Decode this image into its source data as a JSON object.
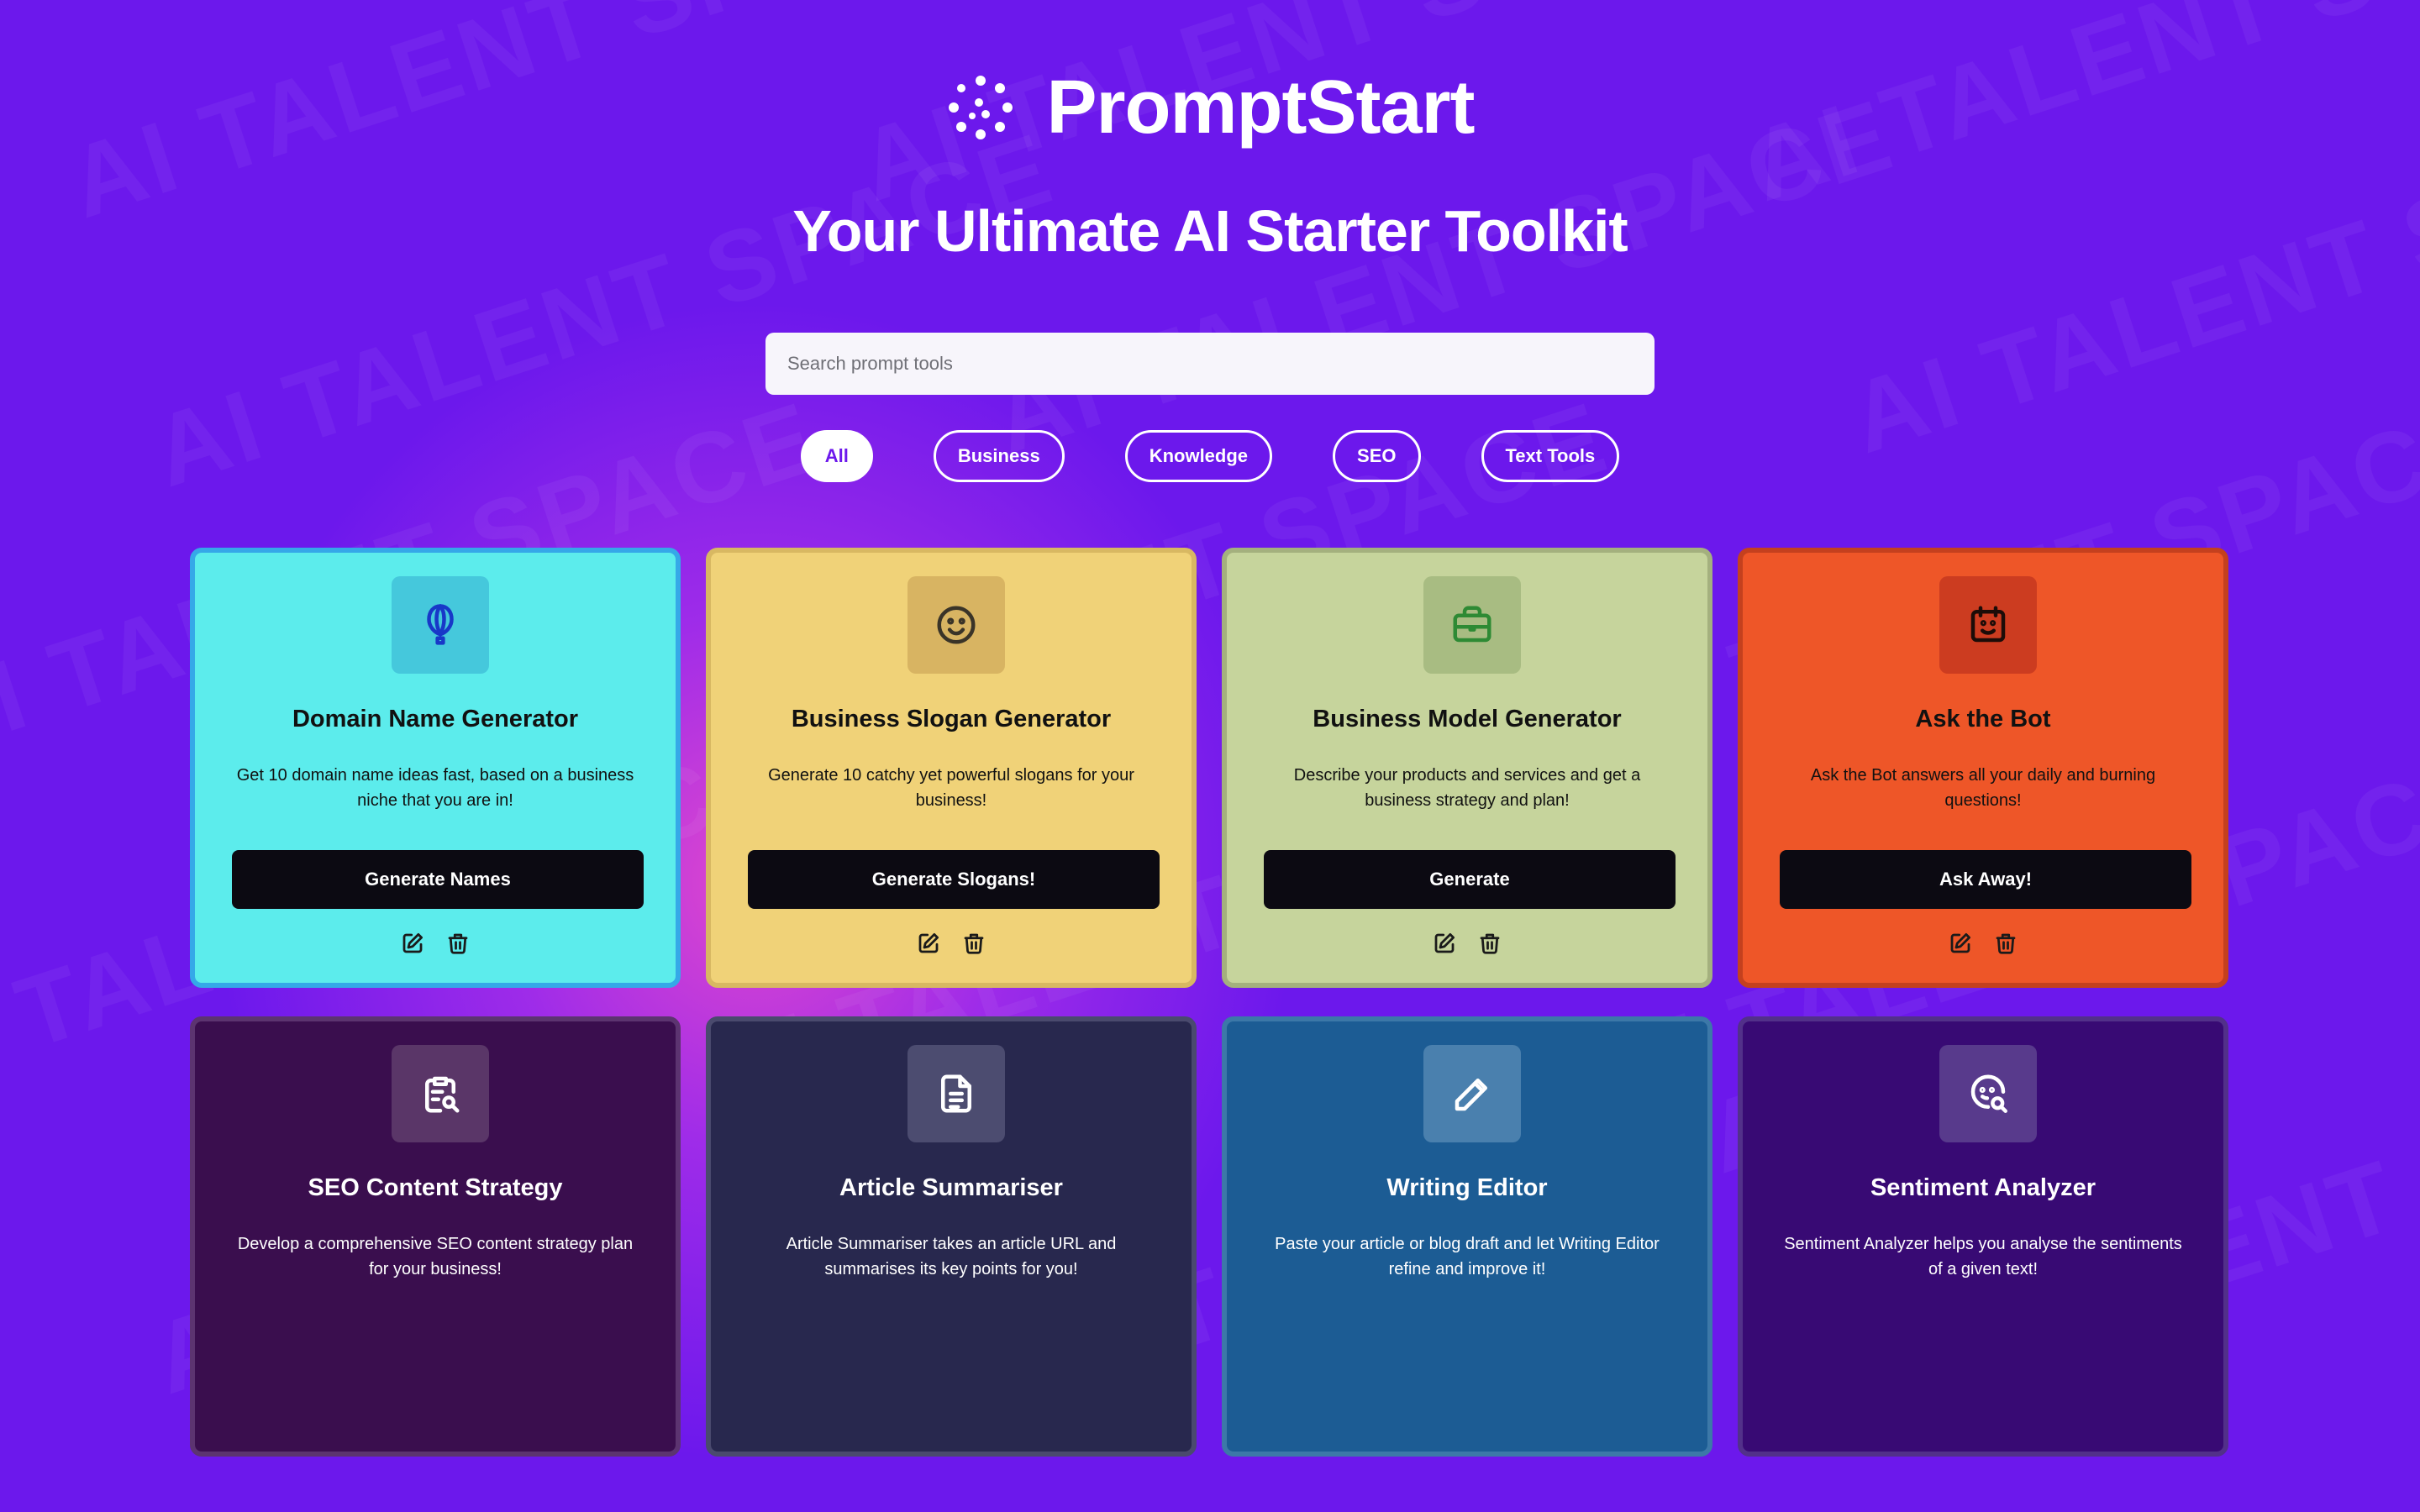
{
  "brand": {
    "name": "PromptStart"
  },
  "tagline": "Your Ultimate AI Starter Toolkit",
  "search": {
    "placeholder": "Search prompt tools",
    "value": ""
  },
  "filters": [
    "All",
    "Business",
    "Knowledge",
    "SEO",
    "Text Tools"
  ],
  "active_filter": "All",
  "watermark_text": "AI TALENT SPACE",
  "cards": [
    {
      "title": "Domain Name Generator",
      "description": "Get 10 domain name ideas fast, based on a business niche that you are in!",
      "button": "Generate Names",
      "icon": "balloon-icon",
      "bg": "#5cecec",
      "border": "#35a8e8",
      "iconBg": "#45c8dc",
      "iconColor": "#1838c8",
      "text": "#111111"
    },
    {
      "title": "Business Slogan Generator",
      "description": "Generate 10 catchy yet powerful slogans for your business!",
      "button": "Generate Slogans!",
      "icon": "smile-icon",
      "bg": "#f0d278",
      "border": "#d8b862",
      "iconBg": "#d8b462",
      "iconColor": "#3a3428",
      "text": "#111111"
    },
    {
      "title": "Business Model Generator",
      "description": "Describe your products and services and get a business strategy and plan!",
      "button": "Generate",
      "icon": "briefcase-icon",
      "bg": "#c6d49c",
      "border": "#a4b07e",
      "iconBg": "#a8bc82",
      "iconColor": "#2e8a34",
      "text": "#111111"
    },
    {
      "title": "Ask the Bot",
      "description": "Ask the Bot answers all your daily and burning questions!",
      "button": "Ask Away!",
      "icon": "calendar-smile-icon",
      "bg": "#ee5628",
      "border": "#c4401e",
      "iconBg": "#cc3c20",
      "iconColor": "#1c0c08",
      "text": "#111111"
    },
    {
      "title": "SEO Content Strategy",
      "description": "Develop a comprehensive SEO content strategy plan for your business!",
      "button": "",
      "icon": "clipboard-search-icon",
      "bg": "#3a0e4e",
      "border": "#5c3470",
      "iconBg": "#5a3668",
      "iconColor": "#ffffff",
      "text": "#ffffff"
    },
    {
      "title": "Article Summariser",
      "description": "Article Summariser takes an article URL and summarises its key points for you!",
      "button": "",
      "icon": "document-icon",
      "bg": "#28284e",
      "border": "#4a4a6e",
      "iconBg": "#4c4c70",
      "iconColor": "#ffffff",
      "text": "#ffffff"
    },
    {
      "title": "Writing Editor",
      "description": "Paste your article or blog draft and let Writing Editor refine and improve it!",
      "button": "",
      "icon": "pencil-icon",
      "bg": "#1c5c94",
      "border": "#3c78a8",
      "iconBg": "#4a80ae",
      "iconColor": "#ffffff",
      "text": "#ffffff"
    },
    {
      "title": "Sentiment Analyzer",
      "description": "Sentiment Analyzer helps you analyse the sentiments of a given text!",
      "button": "",
      "icon": "face-search-icon",
      "bg": "#380a74",
      "border": "#52308a",
      "iconBg": "#583a8c",
      "iconColor": "#ffffff",
      "text": "#ffffff"
    }
  ]
}
